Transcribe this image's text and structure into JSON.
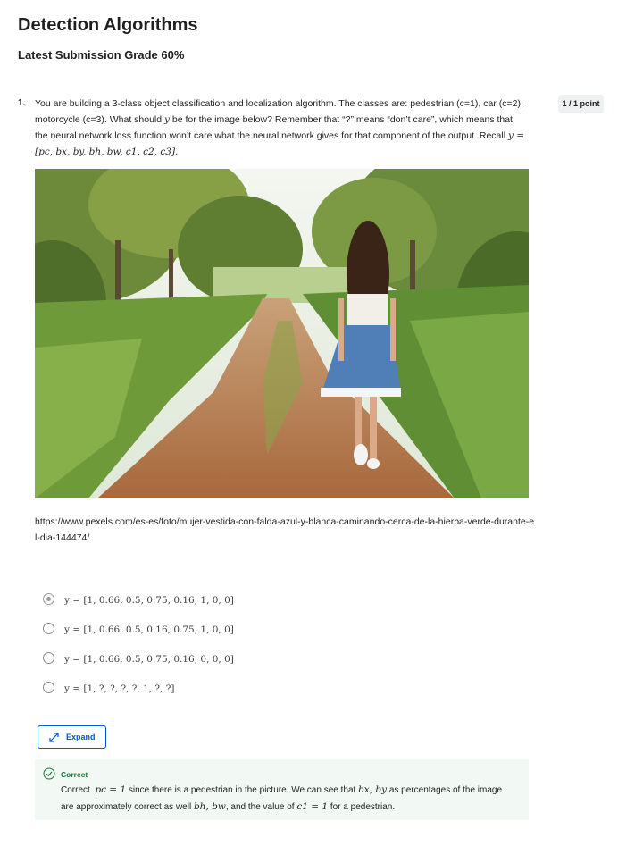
{
  "page": {
    "title": "Detection Algorithms",
    "grade": "Latest Submission Grade 60%"
  },
  "question": {
    "number": "1.",
    "text_part1": "You are building a 3-class object classification and localization algorithm. The classes are: pedestrian (c=1), car (c=2), motorcycle (c=3). What should ",
    "var_y": "y",
    "text_part2": " be for the image below? Remember that “?” means “don’t care”, which means that the neural network loss function won’t care what the neural network gives for that component of the output. Recall ",
    "recall_formula": "y = [pc, bx, by, bh, bw, c1, c2, c3].",
    "points": "1 / 1 point",
    "image_url": "https://www.pexels.com/es-es/foto/mujer-vestida-con-falda-azul-y-blanca-caminando-cerca-de-la-hierba-verde-durante-el-dia-144474/",
    "image_icon": "photo-of-woman-walking-on-dirt-path",
    "options": [
      {
        "label": "y = [1, 0.66, 0.5, 0.75, 0.16, 1, 0, 0]",
        "selected": true
      },
      {
        "label": "y = [1, 0.66, 0.5, 0.16, 0.75, 1, 0, 0]",
        "selected": false
      },
      {
        "label": "y = [1, 0.66, 0.5, 0.75, 0.16, 0, 0, 0]",
        "selected": false
      },
      {
        "label": "y = [1, ?, ?, ?, ?, 1, ?, ?]",
        "selected": false
      }
    ]
  },
  "expand_button": {
    "label": "Expand",
    "icon": "expand-arrows-icon"
  },
  "feedback": {
    "status": "Correct",
    "icon": "check-circle-icon",
    "text_part1": "Correct. ",
    "pc_expr": "pc = 1",
    "text_part2": " since there is a pedestrian in the picture. We can see that ",
    "bxby_expr": "bx, by",
    "text_part3": " as percentages of the image are approximately correct as well ",
    "bhbw_expr": "bh, bw",
    "text_part4": ", and the value of ",
    "c1_expr": "c1 = 1",
    "text_part5": " for a pedestrian."
  },
  "colors": {
    "accent": "#0056d2",
    "correct_green": "#1e7a3c",
    "feedback_bg": "#f2f8f4",
    "badge_bg": "#eef0f2"
  }
}
